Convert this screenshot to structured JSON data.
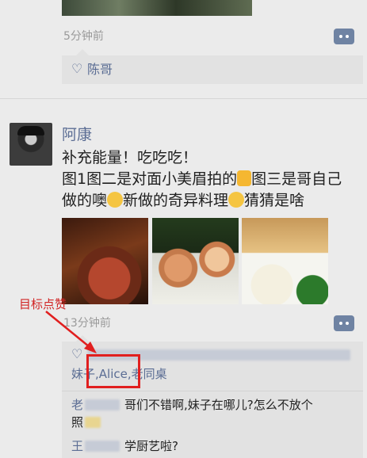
{
  "top_post": {
    "time": "5分钟前",
    "likes": "陈哥"
  },
  "post": {
    "author": "阿康",
    "text_line1": "补充能量！吃吃吃！",
    "text_line2": "图1图二是对面小美眉拍的",
    "text_line2b": "图三是哥自己",
    "text_line3": "做的噢",
    "text_line3b": "新做的奇异料理",
    "text_line3c": "猜猜是啥",
    "time": "13分钟前",
    "like_tail_1": "妹子,",
    "like_alice": "Alice",
    "like_tail_2": ",老同桌",
    "comment1_text": "哥们不错啊,妹子在哪儿?怎么不放个",
    "comment1_wrap": "照",
    "comment2_text": "学厨艺啦?",
    "comment1_initial": "老",
    "comment2_initial": "王"
  },
  "annotation": {
    "label": "目标点赞"
  },
  "colors": {
    "link_blue": "#5b6d94",
    "annotation_red": "#e11f1f"
  }
}
